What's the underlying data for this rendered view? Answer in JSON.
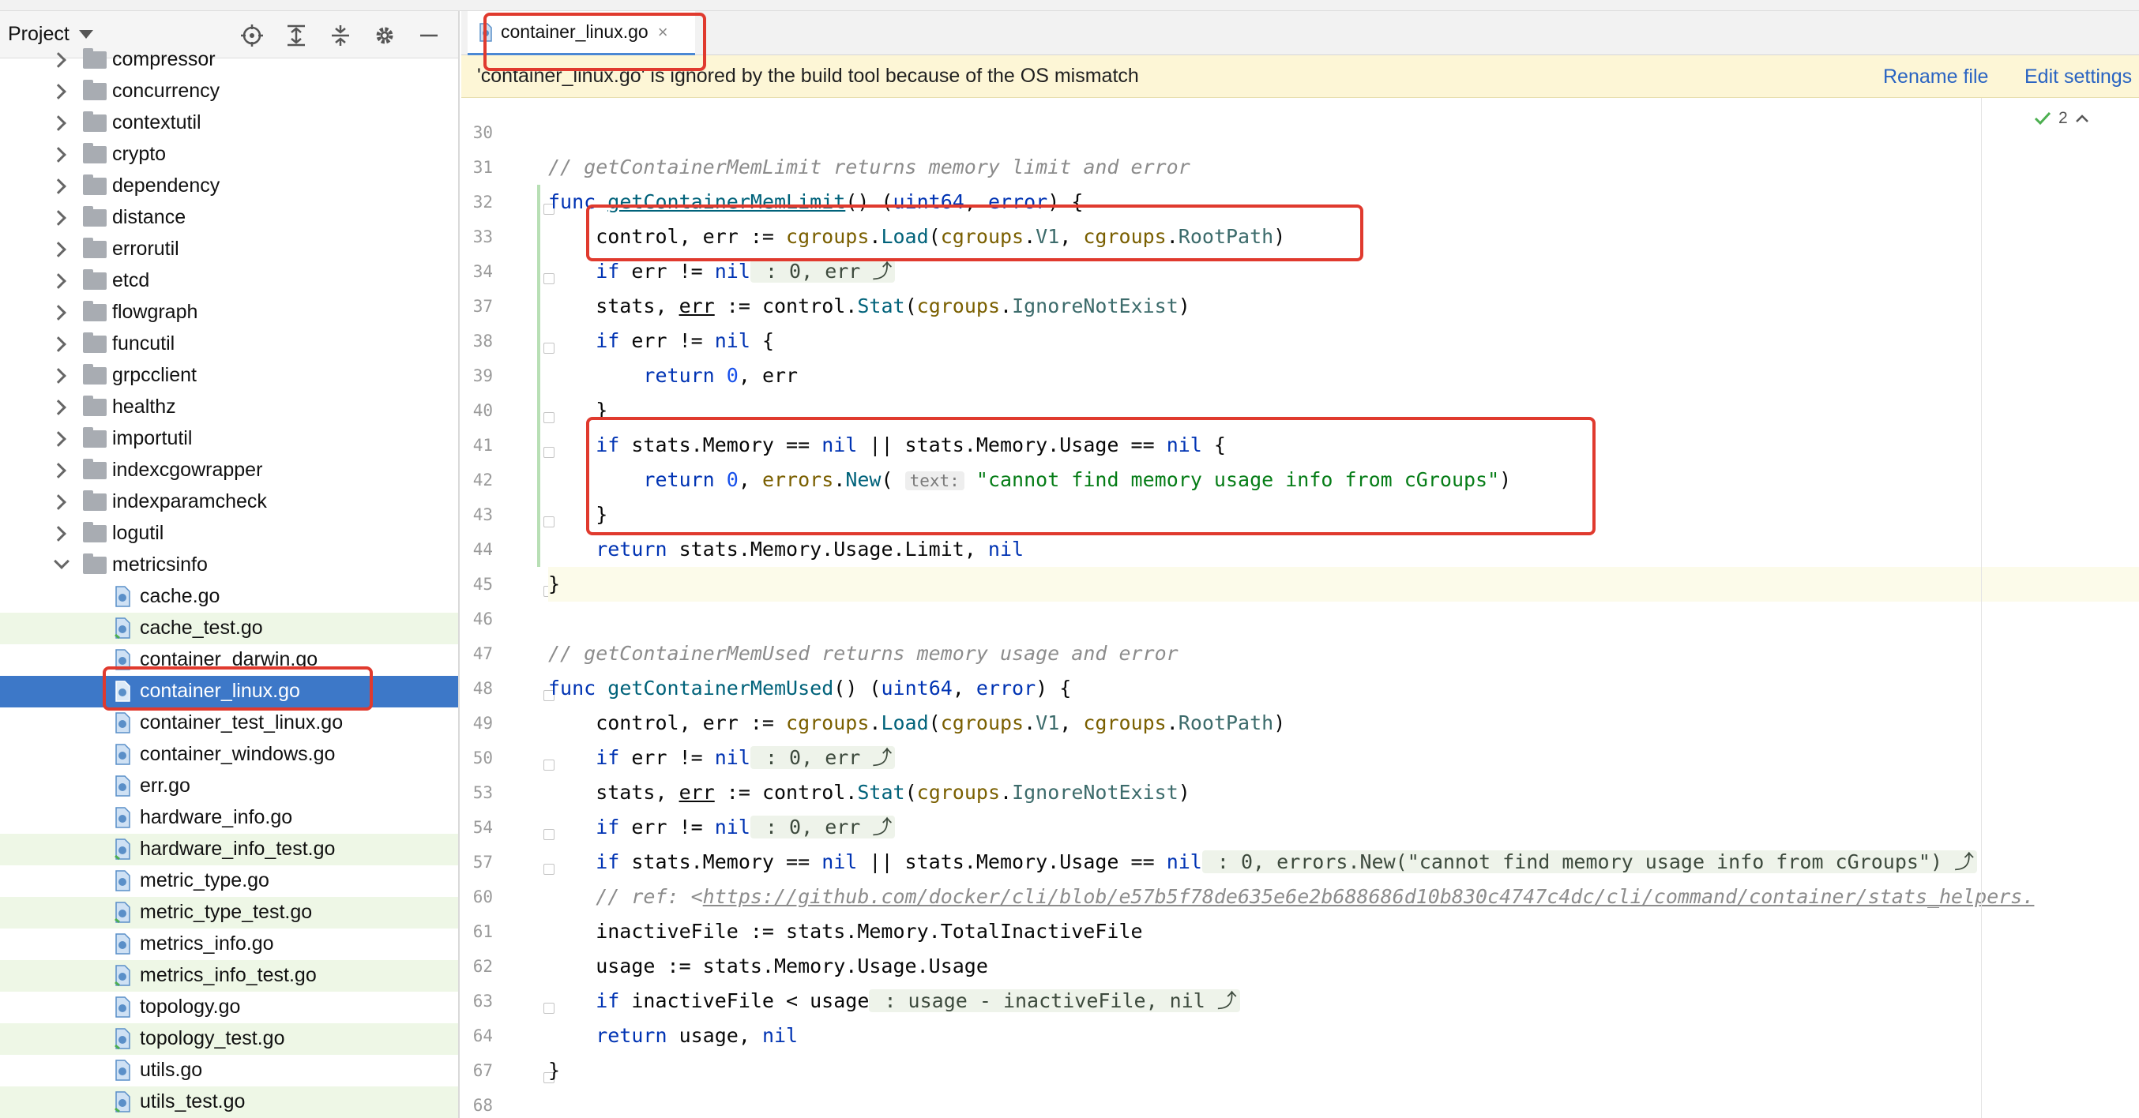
{
  "project_panel": {
    "title": "Project",
    "tools": [
      "locate-icon",
      "expand-all-icon",
      "collapse-all-icon",
      "gear-icon",
      "minimize-icon"
    ],
    "folders": [
      {
        "name": "compressor"
      },
      {
        "name": "concurrency"
      },
      {
        "name": "contextutil"
      },
      {
        "name": "crypto"
      },
      {
        "name": "dependency"
      },
      {
        "name": "distance"
      },
      {
        "name": "errorutil"
      },
      {
        "name": "etcd"
      },
      {
        "name": "flowgraph"
      },
      {
        "name": "funcutil"
      },
      {
        "name": "grpcclient"
      },
      {
        "name": "healthz"
      },
      {
        "name": "importutil"
      },
      {
        "name": "indexcgowrapper"
      },
      {
        "name": "indexparamcheck"
      },
      {
        "name": "logutil"
      },
      {
        "name": "metricsinfo"
      }
    ],
    "files": [
      {
        "name": "cache.go"
      },
      {
        "name": "cache_test.go"
      },
      {
        "name": "container_darwin.go"
      },
      {
        "name": "container_linux.go"
      },
      {
        "name": "container_test_linux.go"
      },
      {
        "name": "container_windows.go"
      },
      {
        "name": "err.go"
      },
      {
        "name": "hardware_info.go"
      },
      {
        "name": "hardware_info_test.go"
      },
      {
        "name": "metric_type.go"
      },
      {
        "name": "metric_type_test.go"
      },
      {
        "name": "metrics_info.go"
      },
      {
        "name": "metrics_info_test.go"
      },
      {
        "name": "topology.go"
      },
      {
        "name": "topology_test.go"
      },
      {
        "name": "utils.go"
      },
      {
        "name": "utils_test.go"
      }
    ]
  },
  "editor": {
    "tab": {
      "label": "container_linux.go",
      "close": "×"
    },
    "banner": {
      "message": "'container_linux.go' is ignored by the build tool because of the OS mismatch",
      "rename": "Rename file",
      "edit": "Edit settings"
    },
    "inspection": {
      "count": "2"
    },
    "line_numbers": [
      "30",
      "31",
      "32",
      "33",
      "34",
      "37",
      "38",
      "39",
      "40",
      "41",
      "42",
      "43",
      "44",
      "45",
      "46",
      "47",
      "48",
      "49",
      "50",
      "53",
      "54",
      "57",
      "60",
      "61",
      "62",
      "63",
      "64",
      "67",
      "68"
    ],
    "code": {
      "l31_cmt_name": "// getContainerMemLimit",
      "l31_cmt_rest": " returns memory limit and error",
      "l32_func": "func",
      "l32_name": "getContainerMemLimit",
      "l32_sig_a": "() (",
      "l32_uint": "uint64",
      "l32_sep": ", ",
      "l32_err": "error",
      "l32_close": ") {",
      "l33_a": "    control, err := ",
      "l33_pkg1": "cgroups",
      "l33_dot1": ".",
      "l33_load": "Load",
      "l33_p": "(",
      "l33_pkg2": "cgroups",
      "l33_dot2": ".",
      "l33_v1": "V1",
      "l33_sep": ", ",
      "l33_pkg3": "cgroups",
      "l33_dot3": ".",
      "l33_root": "RootPath",
      "l33_end": ")",
      "l34_if": "    if",
      "l34_mid": " err != ",
      "l34_nil": "nil",
      "l34_hint": " : 0, err ⤴",
      "l37_a": "    stats, ",
      "l37_err": "err",
      "l37_b": " := control.",
      "l37_stat": "Stat",
      "l37_p": "(",
      "l37_pkg": "cgroups",
      "l37_dot": ".",
      "l37_ign": "IgnoreNotExist",
      "l37_end": ")",
      "l38_if": "    if",
      "l38_mid": " err != ",
      "l38_nil": "nil",
      "l38_end": " {",
      "l39_ret": "        return",
      "l39_sp": " ",
      "l39_zero": "0",
      "l39_end": ", err",
      "l40": "    }",
      "l41_if": "    if",
      "l41_a": " stats.Memory == ",
      "l41_nil1": "nil",
      "l41_b": " || stats.Memory.Usage == ",
      "l41_nil2": "nil",
      "l41_end": " {",
      "l42_ret": "        return",
      "l42_sp": " ",
      "l42_zero": "0",
      "l42_a": ", ",
      "l42_pkg": "errors",
      "l42_dot": ".",
      "l42_new": "New",
      "l42_p": "(",
      "l42_inlay": "text:",
      "l42_str": "\"cannot find memory usage info from cGroups\"",
      "l42_end": ")",
      "l43": "    }",
      "l44_ret": "    return",
      "l44_a": " stats.Memory.Usage.Limit, ",
      "l44_nil": "nil",
      "l45": "}",
      "l47_cmt_name": "// getContainerMemUsed",
      "l47_cmt_rest": " returns memory usage and error",
      "l48_func": "func",
      "l48_name": "getContainerMemUsed",
      "l48_sig_a": "() (",
      "l48_uint": "uint64",
      "l48_sep": ", ",
      "l48_err": "error",
      "l48_close": ") {",
      "l49_a": "    control, err := ",
      "l49_pkg1": "cgroups",
      "l49_dot1": ".",
      "l49_load": "Load",
      "l49_p": "(",
      "l49_pkg2": "cgroups",
      "l49_dot2": ".",
      "l49_v1": "V1",
      "l49_sep": ", ",
      "l49_pkg3": "cgroups",
      "l49_dot3": ".",
      "l49_root": "RootPath",
      "l49_end": ")",
      "l50_if": "    if",
      "l50_mid": " err != ",
      "l50_nil": "nil",
      "l50_hint": " : 0, err ⤴",
      "l53_a": "    stats, ",
      "l53_err": "err",
      "l53_b": " := control.",
      "l53_stat": "Stat",
      "l53_p": "(",
      "l53_pkg": "cgroups",
      "l53_dot": ".",
      "l53_ign": "IgnoreNotExist",
      "l53_end": ")",
      "l54_if": "    if",
      "l54_mid": " err != ",
      "l54_nil": "nil",
      "l54_hint": " : 0, err ⤴",
      "l57_if": "    if",
      "l57_a": " stats.Memory == ",
      "l57_nil1": "nil",
      "l57_b": " || stats.Memory.Usage == ",
      "l57_nil2": "nil",
      "l57_hint": " : 0, errors.New(\"cannot find memory usage info from cGroups\") ⤴",
      "l60_cmt": "    // ref: <",
      "l60_url": "https://github.com/docker/cli/blob/e57b5f78de635e6e2b688686d10b830c4747c4dc/cli/command/container/stats_helpers.",
      "l61": "    inactiveFile := stats.Memory.TotalInactiveFile",
      "l62": "    usage := stats.Memory.Usage.Usage",
      "l63_if": "    if",
      "l63_a": " inactiveFile < usage",
      "l63_hint": " : usage - inactiveFile, nil ⤴",
      "l64_ret": "    return",
      "l64_a": " usage, ",
      "l64_nil": "nil",
      "l67": "}"
    }
  },
  "colors": {
    "keyword": "#0033b3",
    "function": "#00627a",
    "string": "#067d17",
    "comment": "#8c8c8c",
    "selection": "#3d78c8",
    "banner": "#fdf6d6",
    "annotation": "#e03a2e"
  }
}
